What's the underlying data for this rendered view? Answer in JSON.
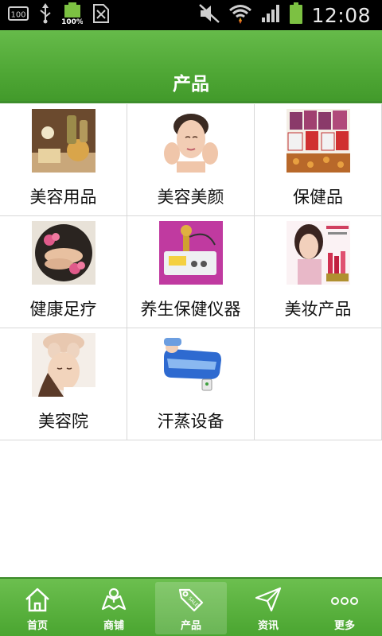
{
  "status_bar": {
    "time": "12:08",
    "left_icons": [
      "sim-card-100-icon",
      "usb-icon",
      "battery-100-icon",
      "sd-card-icon"
    ],
    "battery_small_label": "100%",
    "sim_label": "100",
    "right_icons": [
      "mute-icon",
      "wifi-icon",
      "signal-icon",
      "battery-icon"
    ]
  },
  "header": {
    "title": "产品"
  },
  "categories": [
    {
      "label": "美容用品",
      "icon": "spa-products-image"
    },
    {
      "label": "美容美颜",
      "icon": "face-care-image"
    },
    {
      "label": "保健品",
      "icon": "supplements-image"
    },
    {
      "label": "健康足疗",
      "icon": "foot-massage-image"
    },
    {
      "label": "养生保健仪器",
      "icon": "health-device-image"
    },
    {
      "label": "美妆产品",
      "icon": "cosmetics-image"
    },
    {
      "label": "美容院",
      "icon": "beauty-salon-image"
    },
    {
      "label": "汗蒸设备",
      "icon": "sauna-tub-image"
    }
  ],
  "bottom_nav": [
    {
      "label": "首页",
      "icon": "home-icon",
      "active": false
    },
    {
      "label": "商铺",
      "icon": "shop-map-icon",
      "active": false
    },
    {
      "label": "产品",
      "icon": "sale-tag-icon",
      "active": true
    },
    {
      "label": "资讯",
      "icon": "paper-plane-icon",
      "active": false
    },
    {
      "label": "更多",
      "icon": "more-dots-icon",
      "active": false
    }
  ],
  "colors": {
    "header_green": "#4fa735",
    "nav_green": "#5ab33e",
    "divider": "#d8d8d8",
    "statusbar": "#000000"
  }
}
